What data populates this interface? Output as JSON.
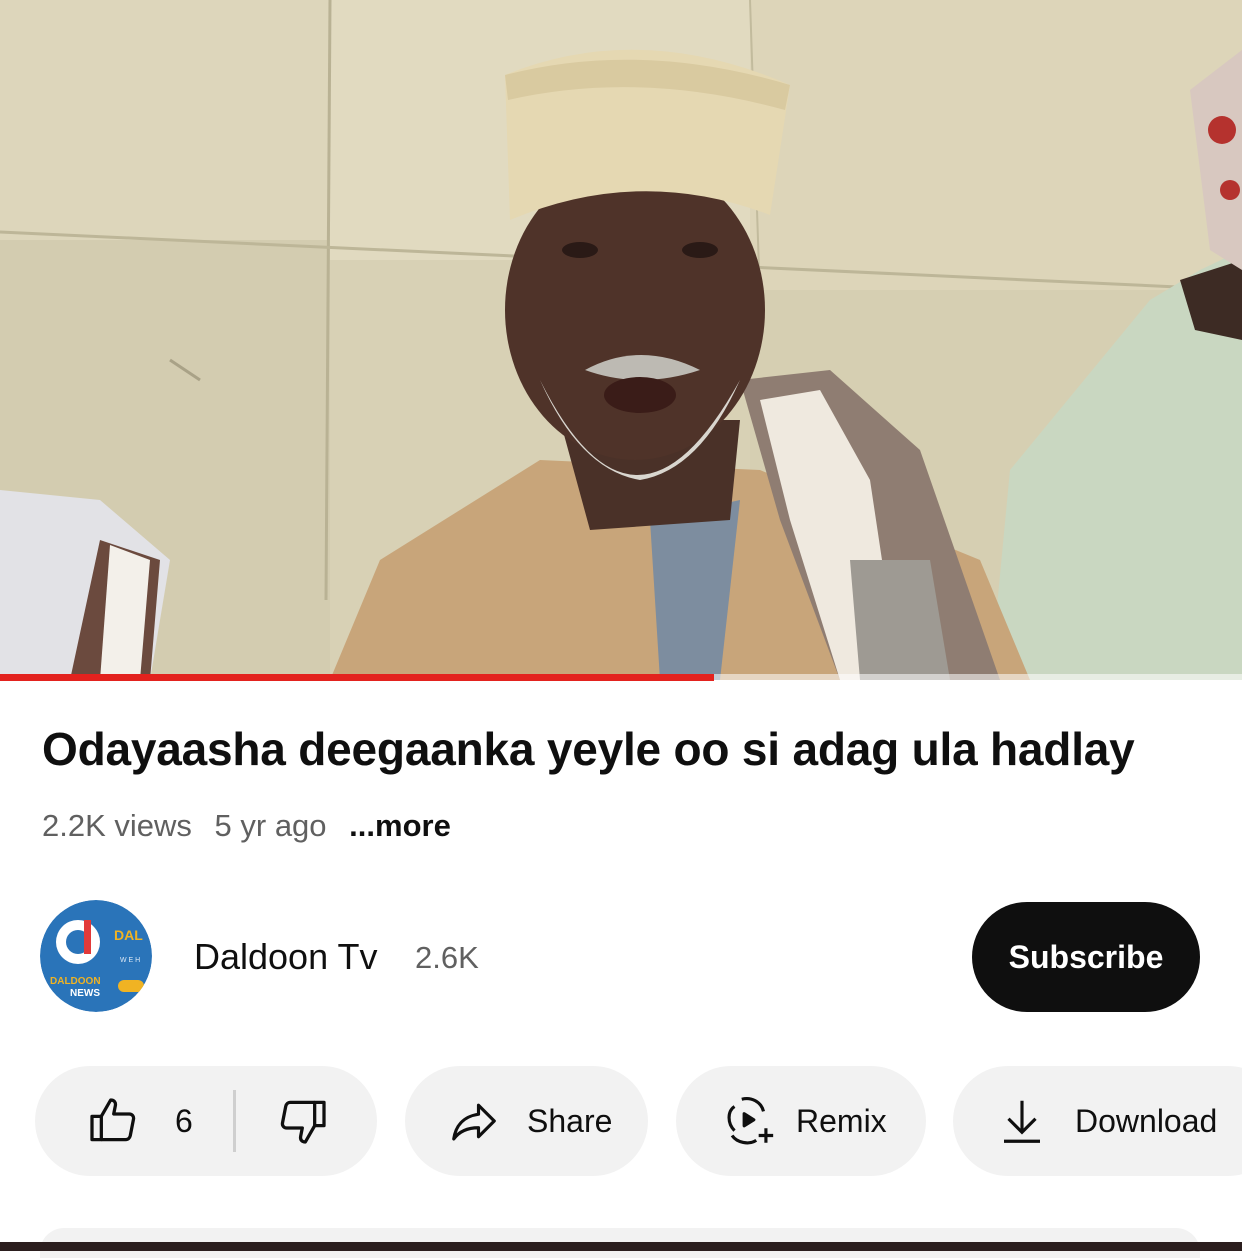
{
  "video": {
    "progress_fraction": 0.575
  },
  "title": "Odayaasha deegaanka yeyle oo si adag ula hadlay",
  "meta": {
    "views": "2.2K views",
    "age": "5 yr ago",
    "more": "...more"
  },
  "channel": {
    "name": "Daldoon Tv",
    "subscribers": "2.6K",
    "subscribe_label": "Subscribe",
    "avatar_logo_text": "DALDOON NEWS"
  },
  "actions": {
    "like_count": "6",
    "share_label": "Share",
    "remix_label": "Remix",
    "download_label": "Download"
  },
  "icons": {
    "like": "thumbs-up-icon",
    "dislike": "thumbs-down-icon",
    "share": "share-arrow-icon",
    "remix": "remix-icon",
    "download": "download-icon"
  },
  "colors": {
    "progress": "#e3221e",
    "subscribe_bg": "#0f0f0f",
    "pill_bg": "#f2f2f2",
    "secondary_text": "#606060"
  }
}
